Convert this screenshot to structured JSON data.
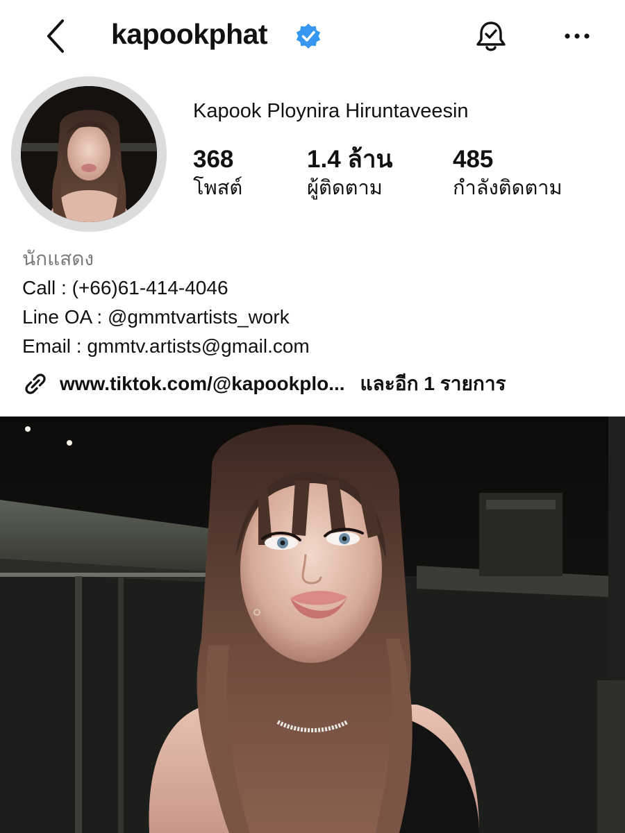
{
  "header": {
    "back_icon": "chevron-left-icon",
    "username": "kapookphat",
    "verified_icon": "verified-badge-icon",
    "verified_color": "#3897f0",
    "notification_icon": "bell-check-icon",
    "more_icon": "more-horizontal-icon"
  },
  "profile": {
    "full_name": "Kapook Ploynira Hiruntaveesin",
    "stats": [
      {
        "value": "368",
        "label": "โพสต์"
      },
      {
        "value": "1.4 ล้าน",
        "label": "ผู้ติดตาม"
      },
      {
        "value": "485",
        "label": "กำลังติดตาม"
      }
    ]
  },
  "bio": {
    "category": "นักแสดง",
    "lines": [
      "Call : (+66)61-414-4046",
      "Line OA : @gmmtvartists_work",
      "Email : gmmtv.artists@gmail.com"
    ]
  },
  "links": {
    "icon": "link-icon",
    "primary": "www.tiktok.com/@kapookplo...",
    "more": "และอีก 1 รายการ"
  }
}
